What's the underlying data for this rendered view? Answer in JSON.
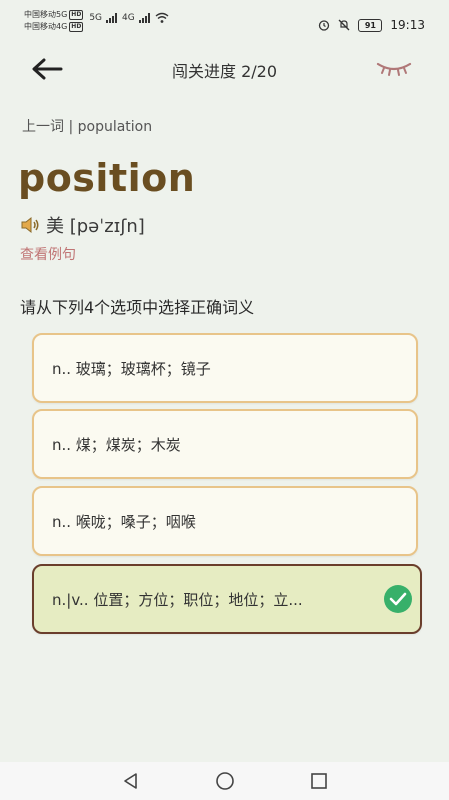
{
  "status_bar": {
    "carrier1": "中国移动5G",
    "carrier1_badge": "HD",
    "carrier2": "中国移动4G",
    "carrier2_badge": "HD",
    "net1": "5G",
    "net2": "4G",
    "battery": "91",
    "time": "19:13"
  },
  "header": {
    "title": "闯关进度 2/20"
  },
  "word_card": {
    "previous_word": "上一词 | population",
    "word": "position",
    "phonetic": "美 [pəˈzɪʃn]",
    "example_link": "查看例句"
  },
  "quiz": {
    "instruction": "请从下列4个选项中选择正确词义",
    "options": [
      {
        "text": "n.. 玻璃；玻璃杯；镜子",
        "state": "normal"
      },
      {
        "text": "n.. 煤；煤炭；木炭",
        "state": "normal"
      },
      {
        "text": "n.. 喉咙；嗓子；咽喉",
        "state": "normal"
      },
      {
        "text": "n.|v.. 位置；方位；职位；地位；立...",
        "state": "correct"
      }
    ]
  },
  "colors": {
    "word": "#6a4e21",
    "option_border": "#e8c489",
    "correct_bg": "#e6ecc2",
    "correct_border": "#6a3e2c",
    "check": "#38b06a",
    "example_link": "#c07575"
  },
  "icons": [
    "back-arrow-icon",
    "eye-closed-icon",
    "speaker-icon",
    "check-circle-icon",
    "nav-back-icon",
    "nav-home-icon",
    "nav-recents-icon"
  ]
}
